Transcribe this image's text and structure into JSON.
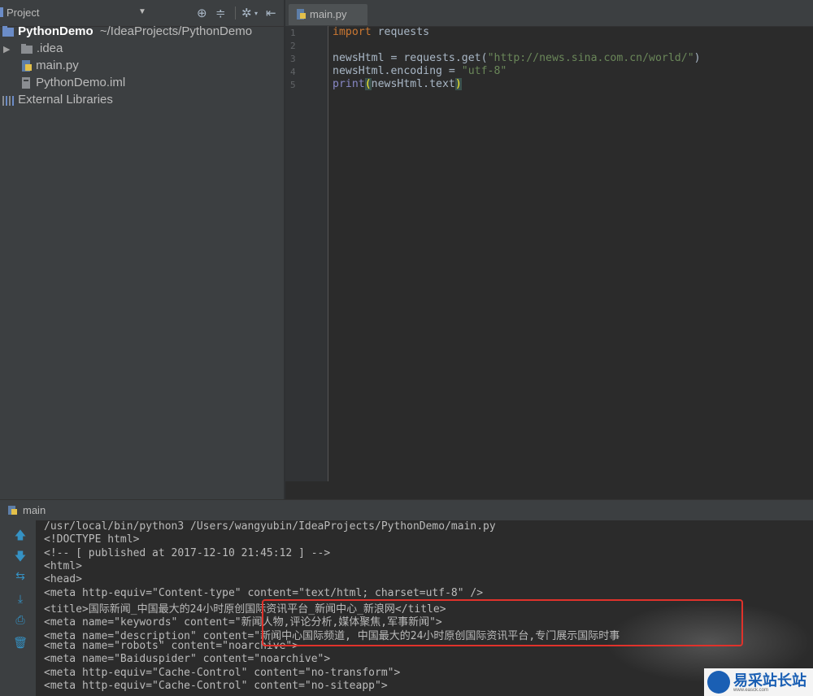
{
  "project": {
    "title": "Project",
    "tree": [
      {
        "label": "PythonDemo",
        "path": "~/IdeaProjects/PythonDemo"
      },
      {
        "label": ".idea"
      },
      {
        "label": "main.py"
      },
      {
        "label": "PythonDemo.iml"
      },
      {
        "label": "External Libraries"
      }
    ]
  },
  "editor": {
    "tab_label": "main.py",
    "line_numbers": [
      "1",
      "2",
      "3",
      "4",
      "5"
    ],
    "lines": {
      "l1_kw": "import",
      "l1_rest": " requests",
      "l3_a": "newsHtml = requests.get(",
      "l3_str": "\"http://news.sina.com.cn/world/\"",
      "l3_b": ")",
      "l4_a": "newsHtml.encoding = ",
      "l4_str": "\"utf-8\"",
      "l5_fn": "print",
      "l5_open": "(",
      "l5_mid": "newsHtml.text",
      "l5_close": ")"
    }
  },
  "run": {
    "title": "main",
    "console": [
      "/usr/local/bin/python3 /Users/wangyubin/IdeaProjects/PythonDemo/main.py",
      "<!DOCTYPE html>",
      "<!-- [ published at 2017-12-10 21:45:12 ] -->",
      "<html>",
      "<head>",
      "<meta http-equiv=\"Content-type\" content=\"text/html; charset=utf-8\" />",
      "<title>国际新闻_中国最大的24小时原创国际资讯平台_新闻中心_新浪网</title>",
      "<meta name=\"keywords\" content=\"新闻人物,评论分析,媒体聚焦,军事新闻\">",
      "<meta name=\"description\" content=\"新闻中心国际频道, 中国最大的24小时原创国际资讯平台,专门展示国际时事",
      "<meta name=\"robots\" content=\"noarchive\">",
      "<meta name=\"Baiduspider\" content=\"noarchive\">",
      "<meta http-equiv=\"Cache-Control\" content=\"no-transform\">",
      "<meta http-equiv=\"Cache-Control\" content=\"no-siteapp\">"
    ]
  },
  "watermark": {
    "text": "易采站长站",
    "sub": "www.easck.com"
  },
  "colors": {
    "keyword": "#cc7832",
    "string": "#6a8759",
    "builtin": "#8888c6",
    "highlight_box": "#e0322b"
  }
}
